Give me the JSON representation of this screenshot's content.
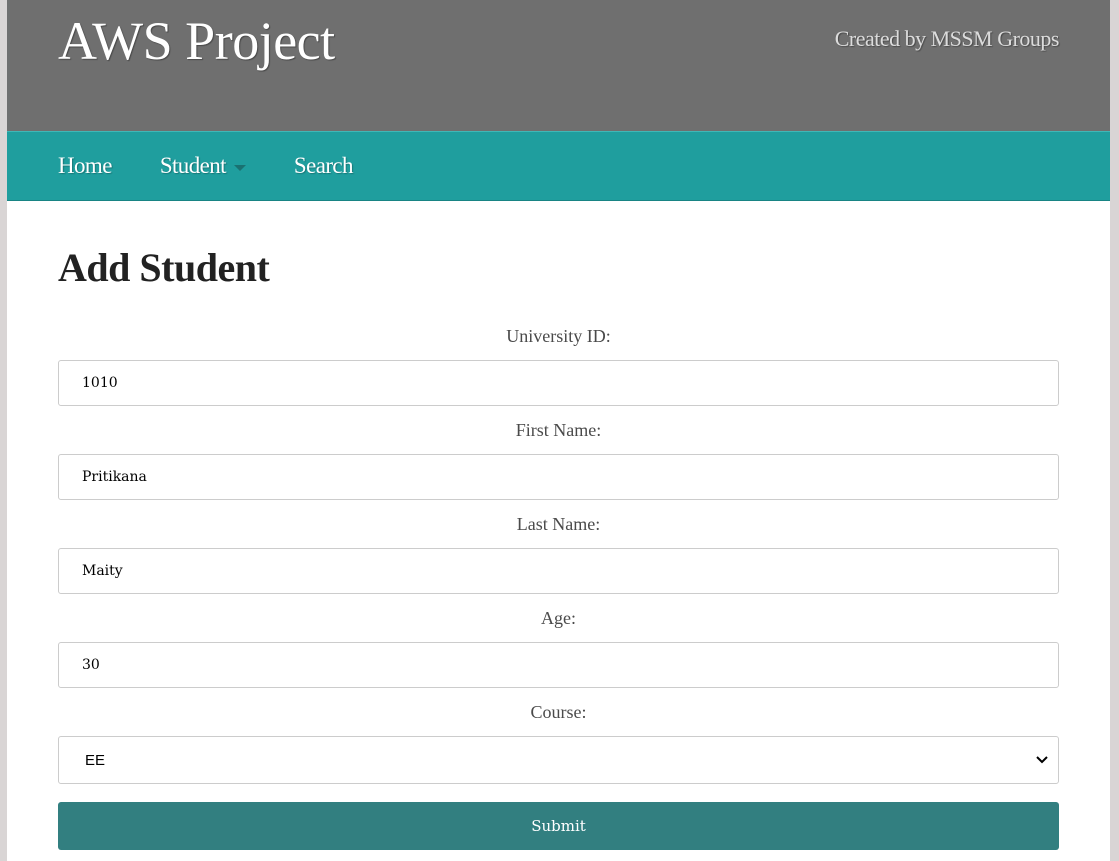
{
  "header": {
    "title": "AWS Project",
    "credit": "Created by MSSM Groups"
  },
  "nav": {
    "items": [
      {
        "label": "Home"
      },
      {
        "label": "Student"
      },
      {
        "label": "Search"
      }
    ]
  },
  "main": {
    "heading": "Add Student",
    "fields": {
      "university_id": {
        "label": "University ID:",
        "value": "1010"
      },
      "first_name": {
        "label": "First Name:",
        "value": "Pritikana"
      },
      "last_name": {
        "label": "Last Name:",
        "value": "Maity"
      },
      "age": {
        "label": "Age:",
        "value": "30"
      },
      "course": {
        "label": "Course:",
        "value": "EE"
      }
    },
    "submit_label": "Submit"
  },
  "icons": {
    "student_dropdown": "caret-down-icon",
    "course_select": "chevron-down-icon"
  },
  "colors": {
    "header_bg": "#6f6f6f",
    "nav_bg": "#1f9e9e",
    "submit_bg": "#327f80"
  }
}
